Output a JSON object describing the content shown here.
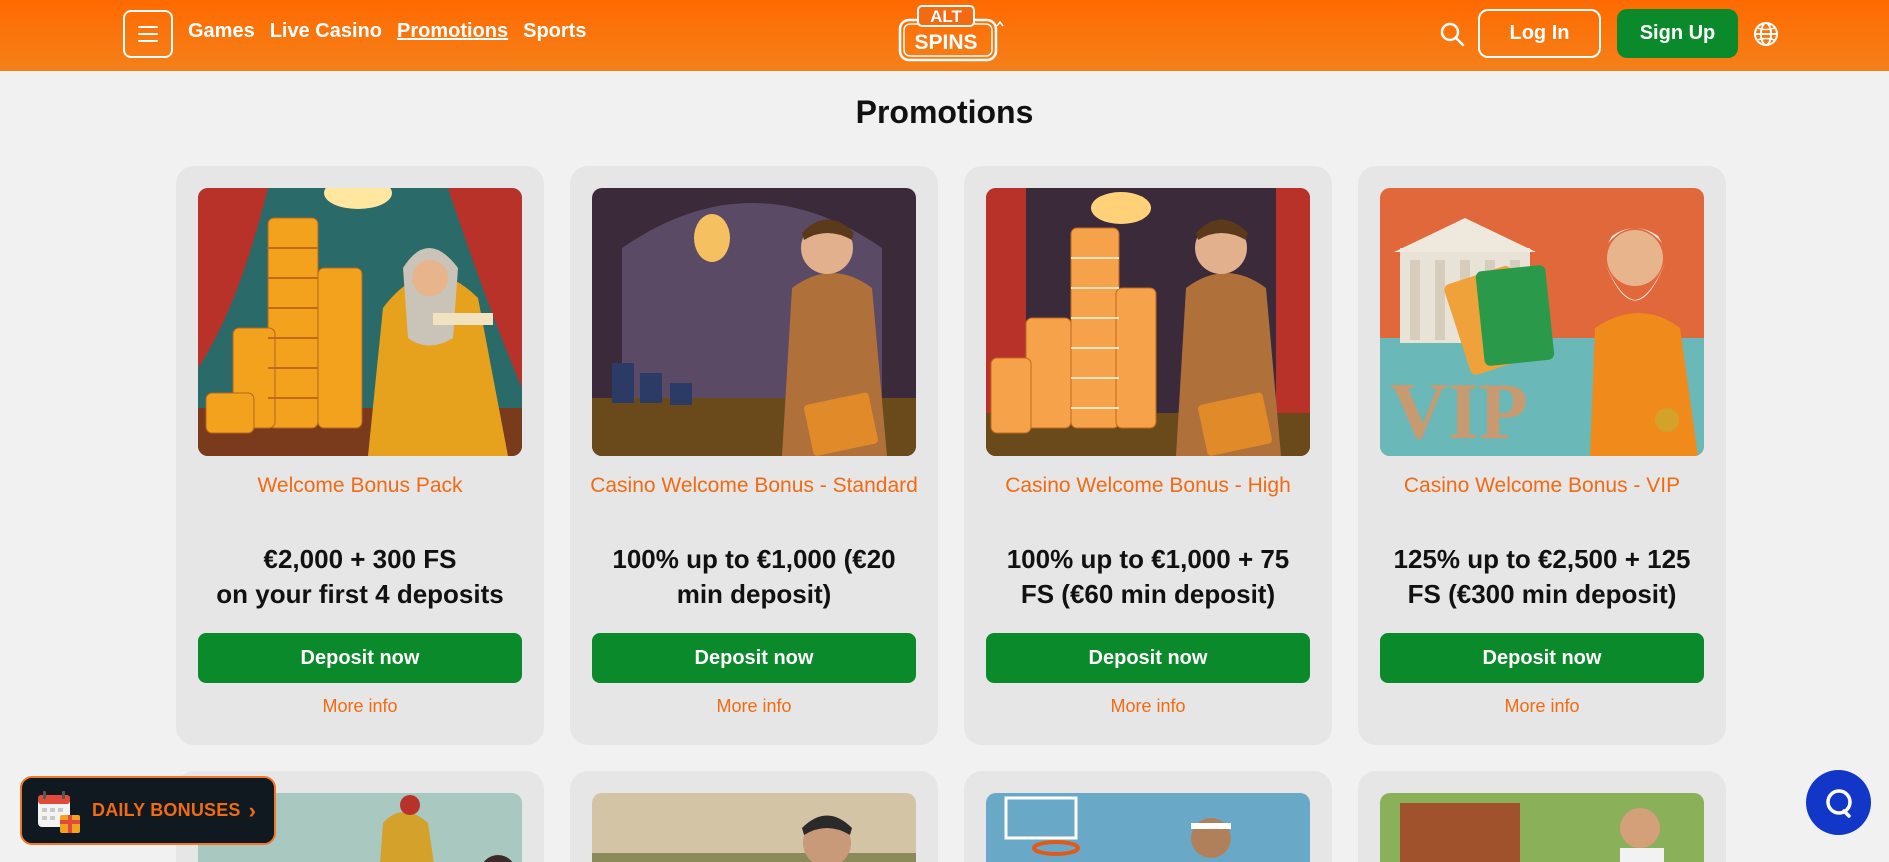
{
  "header": {
    "nav": [
      {
        "label": "Games"
      },
      {
        "label": "Live Casino"
      },
      {
        "label": "Promotions",
        "active": true
      },
      {
        "label": "Sports"
      }
    ],
    "logo_top": "ALT",
    "logo_bottom": "SPINS",
    "login_label": "Log In",
    "signup_label": "Sign Up",
    "icons": [
      "menu-icon",
      "search-icon",
      "globe-icon"
    ]
  },
  "page_title": "Promotions",
  "promotions": [
    {
      "title": "Welcome Bonus Pack",
      "offer_line1": "€2,000 + 300 FS",
      "offer_line2": "on your first 4 deposits",
      "deposit_label": "Deposit now",
      "more_label": "More info"
    },
    {
      "title": "Casino Welcome Bonus - Standard",
      "offer_line1": "100% up to €1,000 (€20",
      "offer_line2": "min deposit)",
      "deposit_label": "Deposit now",
      "more_label": "More info"
    },
    {
      "title": "Casino Welcome Bonus - High",
      "offer_line1": "100% up to €1,000 + 75",
      "offer_line2": "FS (€60 min deposit)",
      "deposit_label": "Deposit now",
      "more_label": "More info"
    },
    {
      "title": "Casino Welcome Bonus - VIP",
      "offer_line1": "125% up to €2,500 + 125",
      "offer_line2": "FS (€300 min deposit)",
      "deposit_label": "Deposit now",
      "more_label": "More info"
    }
  ],
  "daily_bonuses_label": "DAILY BONUSES",
  "colors": {
    "brand_orange": "#ff6a00",
    "accent_green": "#0a8a2a",
    "link_orange": "#f26a12",
    "chat_blue": "#1236c8"
  }
}
